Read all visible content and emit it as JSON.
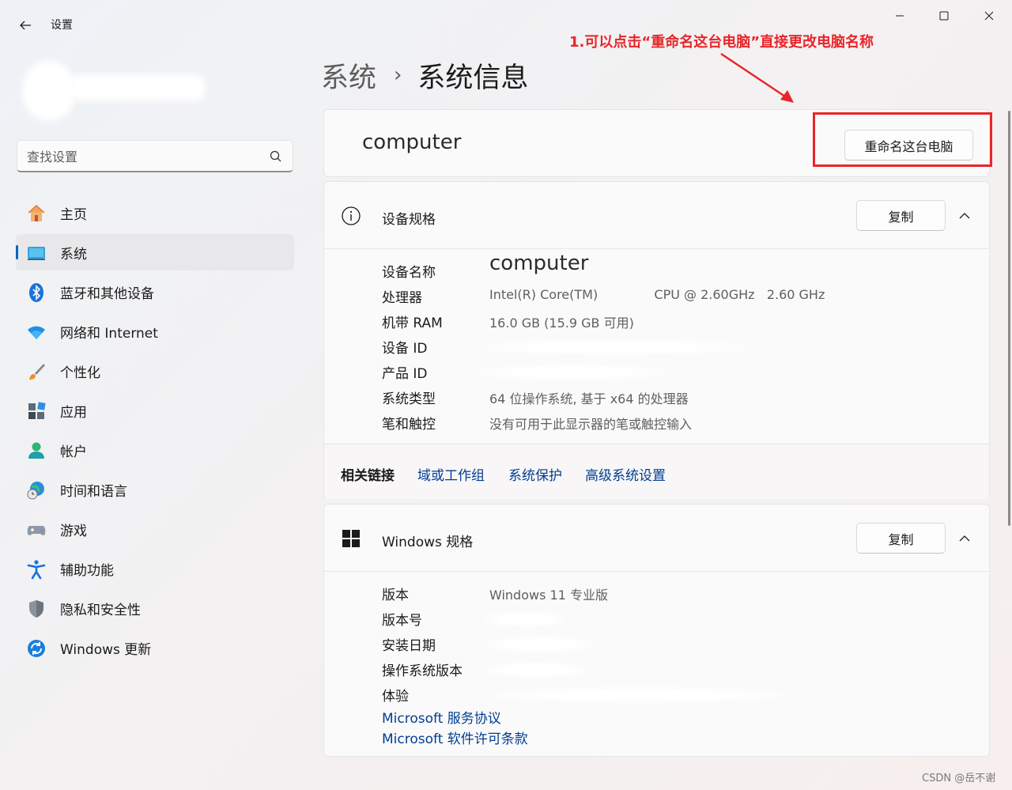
{
  "window": {
    "app_title": "设置"
  },
  "search": {
    "placeholder": "查找设置"
  },
  "sidebar": {
    "items": [
      {
        "label": "主页",
        "icon": "home-icon"
      },
      {
        "label": "系统",
        "icon": "system-icon",
        "selected": true
      },
      {
        "label": "蓝牙和其他设备",
        "icon": "bluetooth-icon"
      },
      {
        "label": "网络和 Internet",
        "icon": "wifi-icon"
      },
      {
        "label": "个性化",
        "icon": "brush-icon"
      },
      {
        "label": "应用",
        "icon": "apps-icon"
      },
      {
        "label": "帐户",
        "icon": "account-icon"
      },
      {
        "label": "时间和语言",
        "icon": "globe-clock-icon"
      },
      {
        "label": "游戏",
        "icon": "gamepad-icon"
      },
      {
        "label": "辅助功能",
        "icon": "accessibility-icon"
      },
      {
        "label": "隐私和安全性",
        "icon": "shield-icon"
      },
      {
        "label": "Windows 更新",
        "icon": "update-icon"
      }
    ]
  },
  "breadcrumb": {
    "parent": "系统",
    "separator": "›",
    "current": "系统信息"
  },
  "annotation": {
    "text": "1.可以点击“重命名这台电脑”直接更改电脑名称",
    "color": "#e8262a"
  },
  "name_card": {
    "device_name": "computer",
    "rename_label": "重命名这台电脑"
  },
  "device_specs": {
    "title": "设备规格",
    "copy_label": "复制",
    "rows": [
      {
        "key": "设备名称",
        "value": "computer"
      },
      {
        "key": "处理器",
        "value": "Intel(R) Core(TM)              CPU @ 2.60GHz   2.60 GHz"
      },
      {
        "key": "机带 RAM",
        "value": "16.0 GB (15.9 GB 可用)"
      },
      {
        "key": "设备 ID",
        "value": ""
      },
      {
        "key": "产品 ID",
        "value": ""
      },
      {
        "key": "系统类型",
        "value": "64 位操作系统, 基于 x64 的处理器"
      },
      {
        "key": "笔和触控",
        "value": "没有可用于此显示器的笔或触控输入"
      }
    ],
    "related_label": "相关链接",
    "related_links": [
      "域或工作组",
      "系统保护",
      "高级系统设置"
    ]
  },
  "windows_specs": {
    "title": "Windows 规格",
    "copy_label": "复制",
    "rows": [
      {
        "key": "版本",
        "value": "Windows 11 专业版"
      },
      {
        "key": "版本号",
        "value": ""
      },
      {
        "key": "安装日期",
        "value": ""
      },
      {
        "key": "操作系统版本",
        "value": ""
      },
      {
        "key": "体验",
        "value": ""
      }
    ],
    "links": [
      "Microsoft 服务协议",
      "Microsoft 软件许可条款"
    ]
  },
  "watermark": "CSDN @岳不谢",
  "colors": {
    "accent": "#0067c0",
    "link": "#003e92",
    "annotation_red": "#e8262a"
  }
}
